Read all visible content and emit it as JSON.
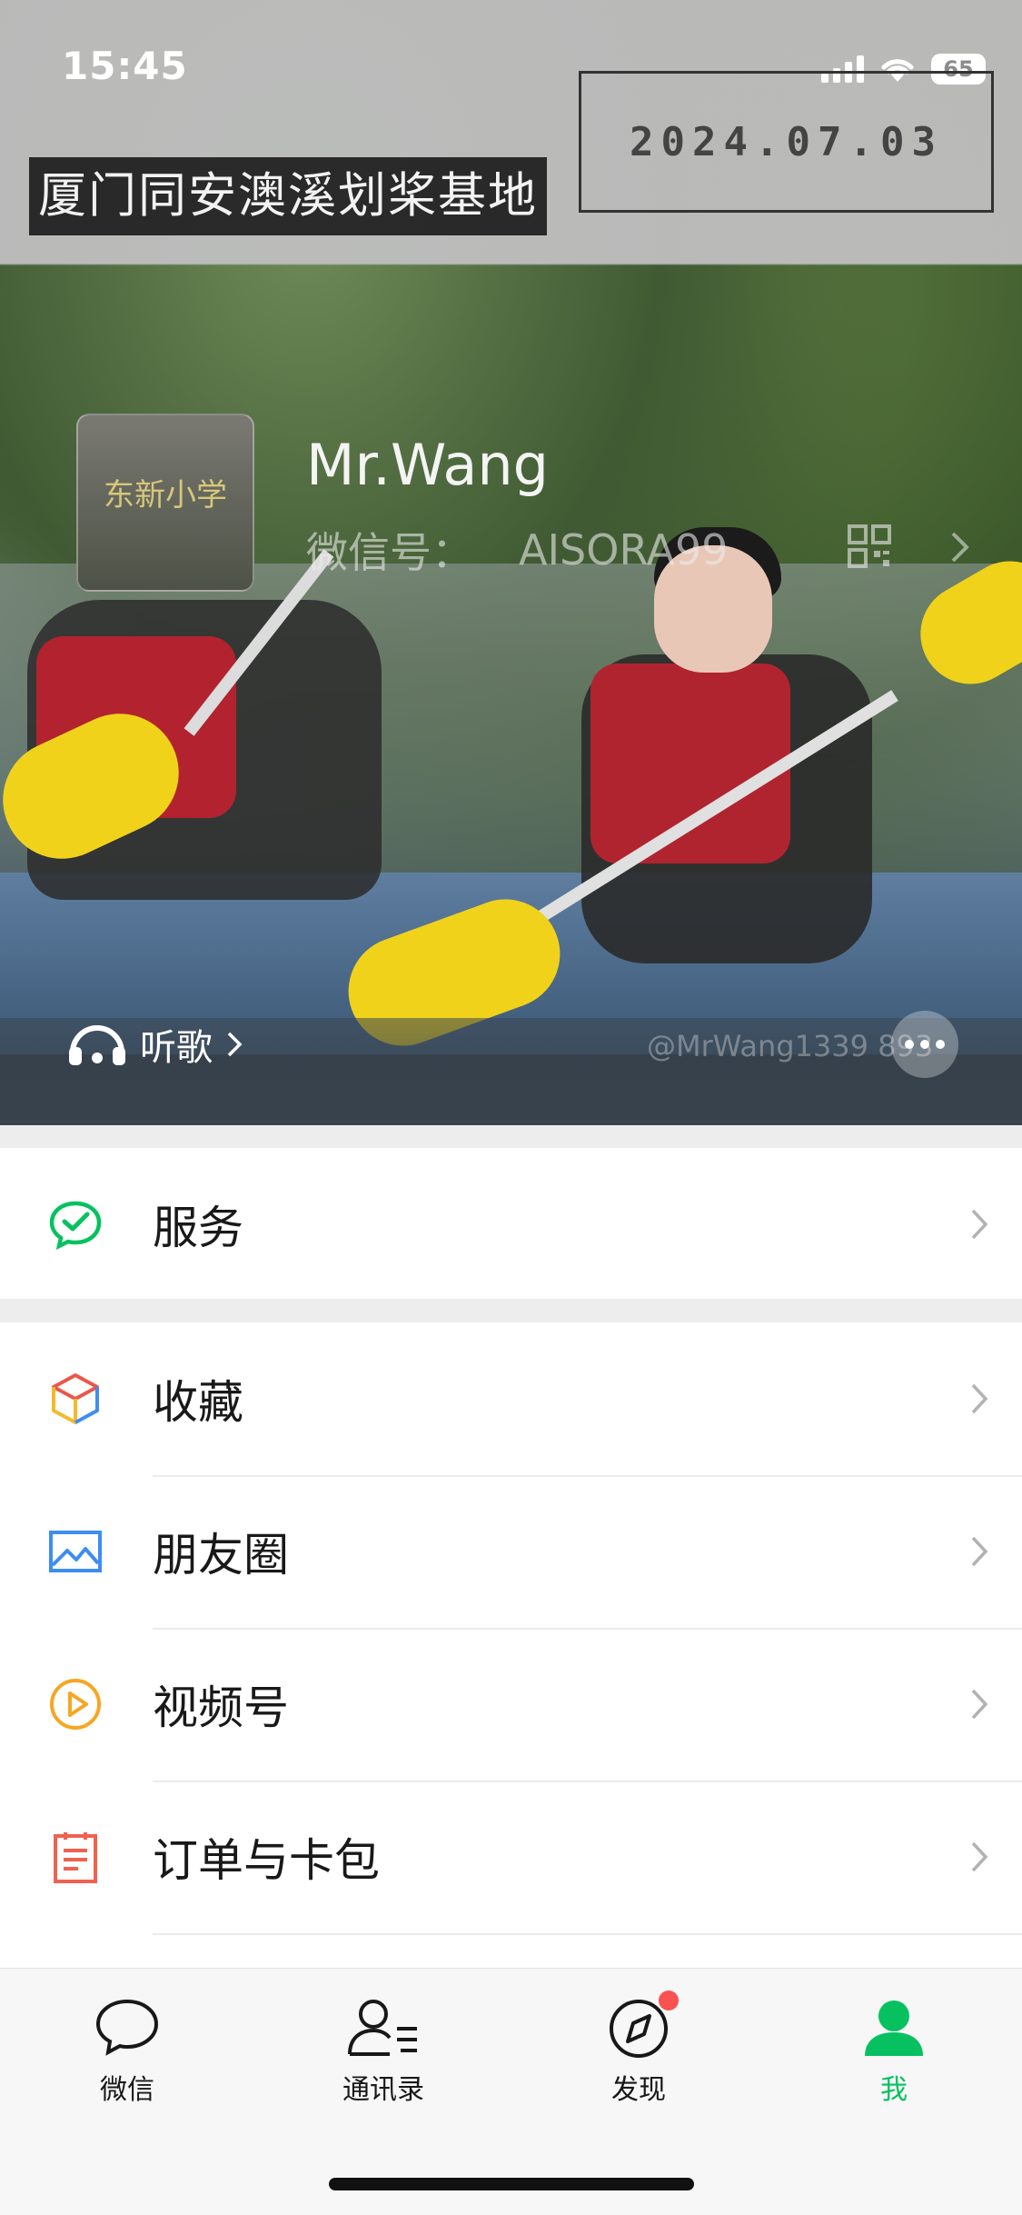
{
  "status_bar": {
    "time": "15:45",
    "battery": "65"
  },
  "hero": {
    "location_tag": "厦门同安澳溪划桨基地",
    "date_stamp": "2024.07.03",
    "avatar_text": "东新小学",
    "nickname": "Mr.Wang",
    "wechat_id_label": "微信号：",
    "wechat_id": "AISORA99",
    "listen_label": "听歌",
    "watermark": "@MrWang1339   893"
  },
  "menu": {
    "service": "服务",
    "favorites": "收藏",
    "moments": "朋友圈",
    "channels": "视频号",
    "orders": "订单与卡包"
  },
  "tabbar": {
    "items": [
      {
        "label": "微信"
      },
      {
        "label": "通讯录"
      },
      {
        "label": "发现"
      },
      {
        "label": "我"
      }
    ],
    "active_color": "#07c160"
  }
}
